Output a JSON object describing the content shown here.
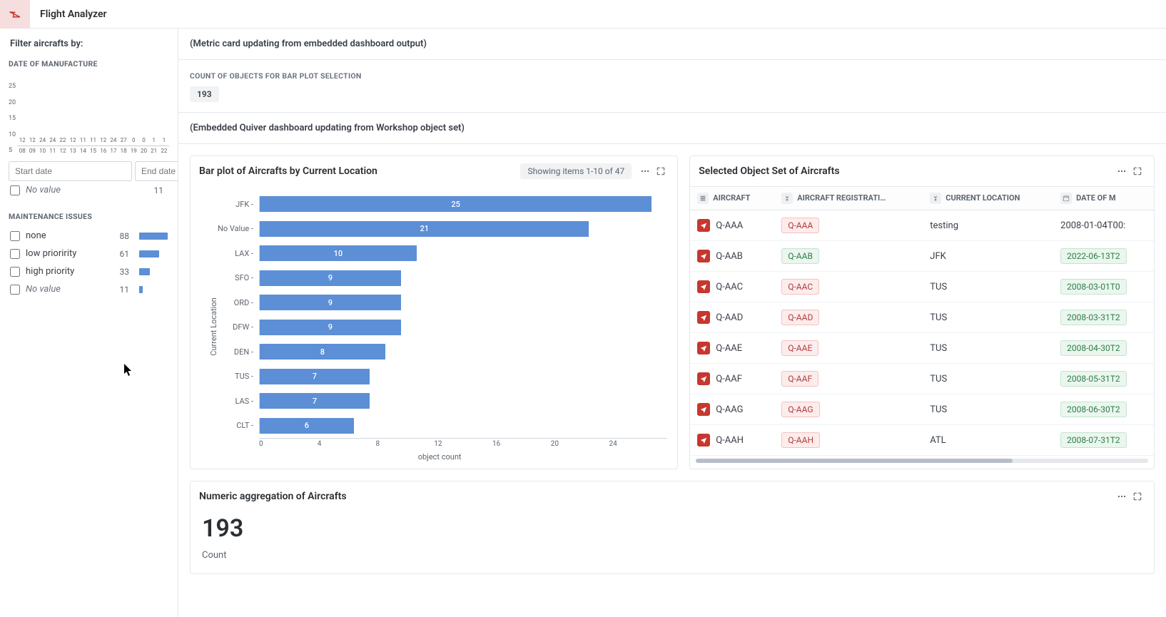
{
  "header": {
    "app_title": "Flight Analyzer"
  },
  "sidebar": {
    "filter_title": "Filter aircrafts by:",
    "date_section_label": "DATE OF MANUFACTURE",
    "date_inputs": {
      "start_placeholder": "Start date",
      "end_placeholder": "End date"
    },
    "date_novalue": {
      "label": "No value",
      "count": "11"
    },
    "maint_section_label": "MAINTENANCE ISSUES",
    "maint_items": [
      {
        "label": "none",
        "count": "88",
        "novalue": false
      },
      {
        "label": "low prioririty",
        "count": "61",
        "novalue": false
      },
      {
        "label": "high priority",
        "count": "33",
        "novalue": false
      },
      {
        "label": "No value",
        "count": "11",
        "novalue": true
      }
    ]
  },
  "chart_data": [
    {
      "id": "date_of_manufacture_histogram",
      "type": "bar",
      "categories": [
        "08",
        "09",
        "10",
        "11",
        "12",
        "13",
        "14",
        "15",
        "16",
        "17",
        "18",
        "19",
        "20",
        "21",
        "22"
      ],
      "values": [
        12,
        12,
        24,
        24,
        22,
        12,
        11,
        11,
        12,
        24,
        27,
        0,
        0,
        1,
        1
      ],
      "title": "DATE OF MANUFACTURE",
      "xlabel": "",
      "ylabel": "",
      "ylim": [
        0,
        30
      ],
      "y_ticks": [
        "25",
        "20",
        "15",
        "10",
        "5"
      ]
    },
    {
      "id": "aircrafts_by_current_location",
      "type": "bar",
      "orientation": "horizontal",
      "categories": [
        "JFK",
        "No Value",
        "LAX",
        "SFO",
        "ORD",
        "DFW",
        "DEN",
        "TUS",
        "LAS",
        "CLT"
      ],
      "values": [
        25,
        21,
        10,
        9,
        9,
        9,
        8,
        7,
        7,
        6
      ],
      "xlabel": "object count",
      "ylabel": "Current Location",
      "xlim": [
        0,
        26
      ],
      "x_ticks": [
        0,
        4,
        8,
        12,
        16,
        20,
        24
      ]
    },
    {
      "id": "maintenance_issues_facet",
      "type": "bar",
      "orientation": "horizontal",
      "categories": [
        "none",
        "low prioririty",
        "high priority",
        "No value"
      ],
      "values": [
        88,
        61,
        33,
        11
      ],
      "xlim": [
        0,
        88
      ]
    }
  ],
  "main": {
    "metric_note": "(Metric card updating from embedded dashboard output)",
    "count_header": "COUNT OF OBJECTS FOR BAR PLOT SELECTION",
    "count_value": "193",
    "embedded_note": "(Embedded Quiver dashboard updating from Workshop object set)",
    "barplot": {
      "title": "Bar plot of Aircrafts by Current Location",
      "pager": "Showing items 1-10 of 47"
    },
    "table": {
      "title": "Selected Object Set of Aircrafts",
      "columns": [
        "AIRCRAFT",
        "AIRCRAFT REGISTRATI…",
        "CURRENT LOCATION",
        "DATE OF M"
      ],
      "rows": [
        {
          "aircraft": "Q-AAA",
          "reg": "Q-AAA",
          "reg_style": "red",
          "loc": "testing",
          "date": "2008-01-04T00:",
          "date_pill": false
        },
        {
          "aircraft": "Q-AAB",
          "reg": "Q-AAB",
          "reg_style": "green",
          "loc": "JFK",
          "date": "2022-06-13T2",
          "date_pill": true
        },
        {
          "aircraft": "Q-AAC",
          "reg": "Q-AAC",
          "reg_style": "red",
          "loc": "TUS",
          "date": "2008-03-01T0",
          "date_pill": true
        },
        {
          "aircraft": "Q-AAD",
          "reg": "Q-AAD",
          "reg_style": "red",
          "loc": "TUS",
          "date": "2008-03-31T2",
          "date_pill": true
        },
        {
          "aircraft": "Q-AAE",
          "reg": "Q-AAE",
          "reg_style": "red",
          "loc": "TUS",
          "date": "2008-04-30T2",
          "date_pill": true
        },
        {
          "aircraft": "Q-AAF",
          "reg": "Q-AAF",
          "reg_style": "red",
          "loc": "TUS",
          "date": "2008-05-31T2",
          "date_pill": true
        },
        {
          "aircraft": "Q-AAG",
          "reg": "Q-AAG",
          "reg_style": "red",
          "loc": "TUS",
          "date": "2008-06-30T2",
          "date_pill": true
        },
        {
          "aircraft": "Q-AAH",
          "reg": "Q-AAH",
          "reg_style": "red",
          "loc": "ATL",
          "date": "2008-07-31T2",
          "date_pill": true
        }
      ]
    },
    "agg": {
      "title": "Numeric aggregation of Aircrafts",
      "value": "193",
      "label": "Count"
    }
  }
}
